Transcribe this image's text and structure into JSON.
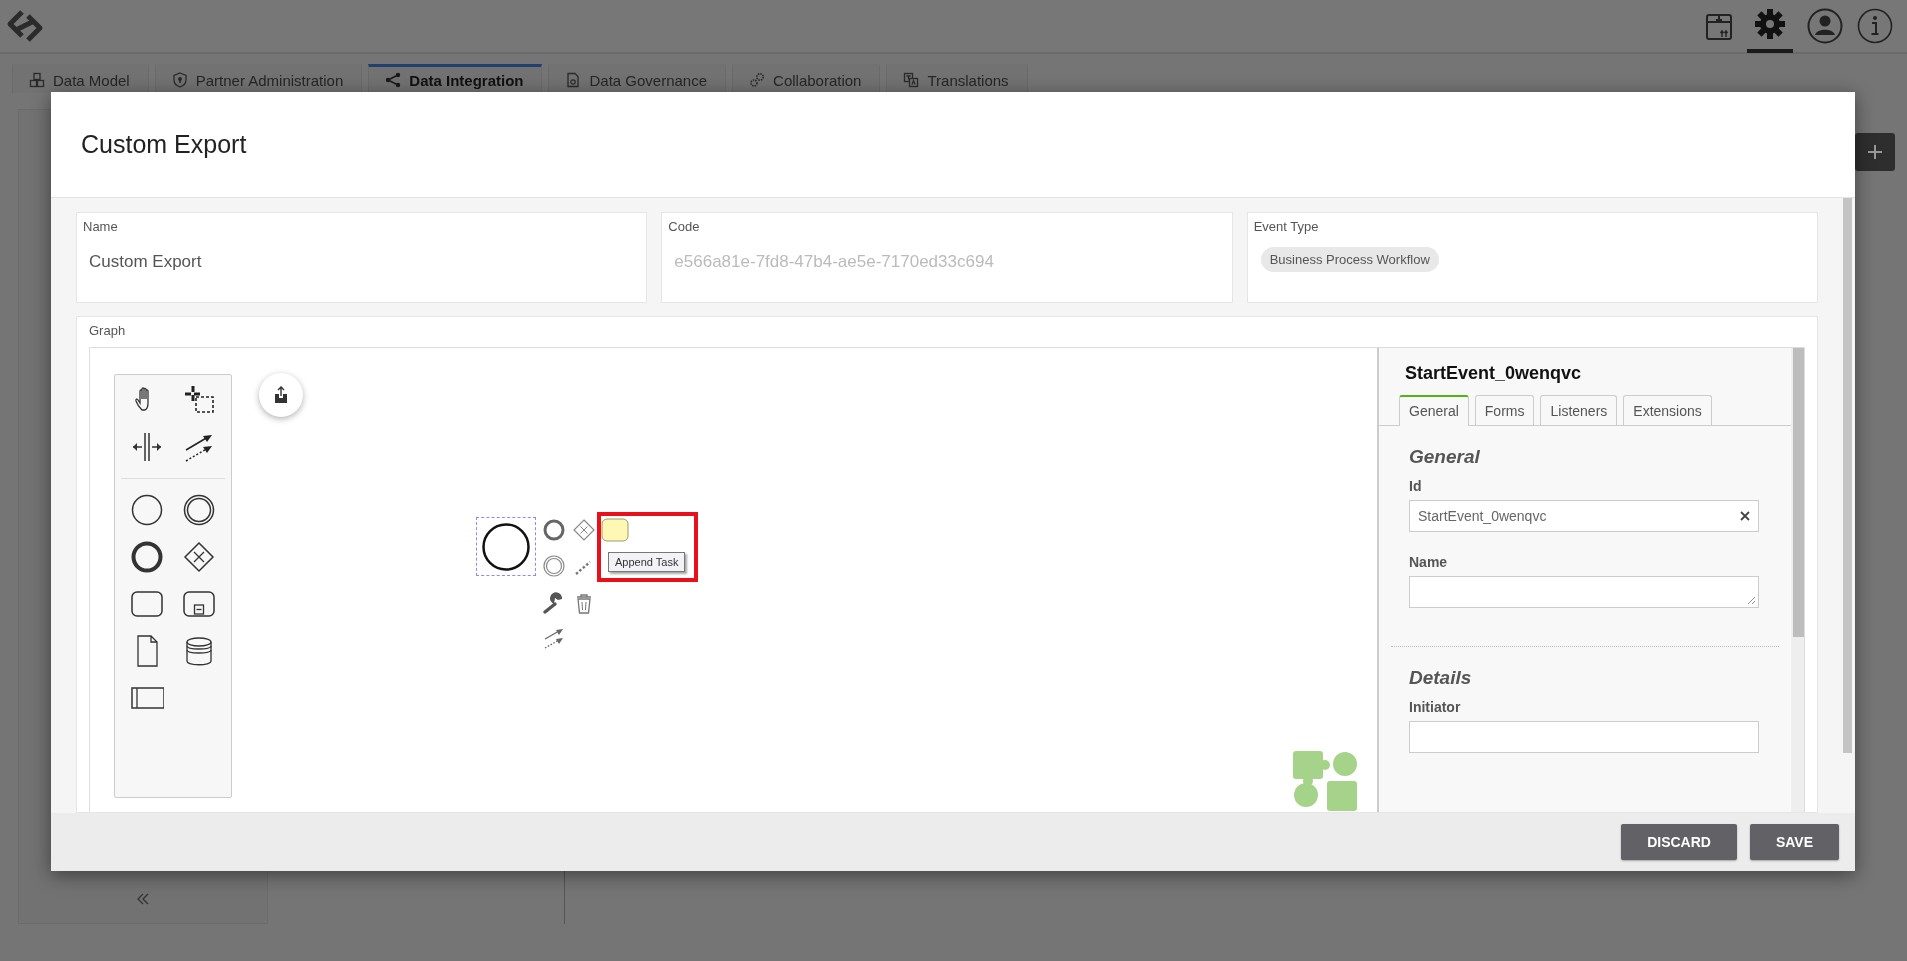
{
  "header": {
    "tabs": [
      {
        "label": "Data Model",
        "selected": false
      },
      {
        "label": "Partner Administration",
        "selected": false
      },
      {
        "label": "Data Integration",
        "selected": true
      },
      {
        "label": "Data Governance",
        "selected": false
      },
      {
        "label": "Collaboration",
        "selected": false
      },
      {
        "label": "Translations",
        "selected": false
      }
    ]
  },
  "dialog": {
    "title": "Custom Export",
    "fields": [
      {
        "kind": "text",
        "label": "Name",
        "value": "Custom Export",
        "disabled": false
      },
      {
        "kind": "text",
        "label": "Code",
        "value": "e566a81e-7fd8-47b4-ae5e-7170ed33c694",
        "disabled": true
      },
      {
        "kind": "chip",
        "label": "Event Type",
        "value": "Business Process Workflow",
        "disabled": false
      }
    ],
    "graph": {
      "label": "Graph",
      "tooltip": "Append Task",
      "properties": {
        "title": "StartEvent_0wenqvc",
        "tabs": [
          {
            "label": "General",
            "selected": true
          },
          {
            "label": "Forms",
            "selected": false
          },
          {
            "label": "Listeners",
            "selected": false
          },
          {
            "label": "Extensions",
            "selected": false
          }
        ],
        "sections": [
          {
            "title": "General",
            "fields": [
              {
                "kind": "input",
                "label": "Id",
                "value": "StartEvent_0wenqvc"
              },
              {
                "kind": "textarea",
                "label": "Name"
              }
            ]
          },
          {
            "title": "Details",
            "fields": [
              {
                "kind": "input",
                "label": "Initiator"
              }
            ]
          }
        ]
      }
    },
    "buttons": [
      {
        "label": "DISCARD"
      },
      {
        "label": "SAVE"
      }
    ]
  }
}
